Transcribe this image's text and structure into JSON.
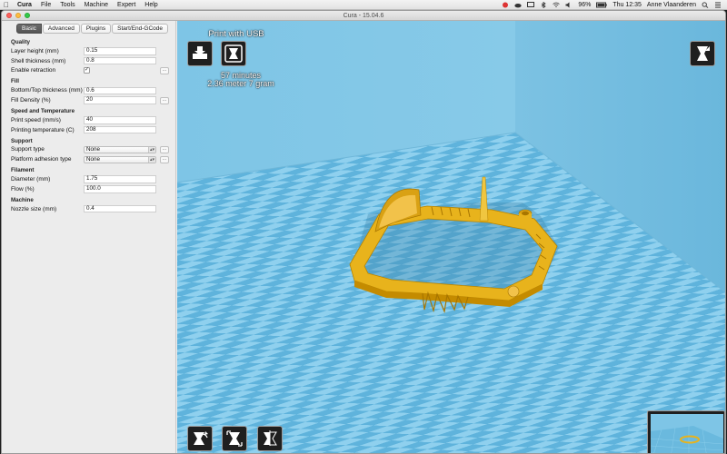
{
  "menubar": {
    "app": "Cura",
    "items": [
      "File",
      "Tools",
      "Machine",
      "Expert",
      "Help"
    ],
    "battery": "96%",
    "clock": "Thu 12:35",
    "user": "Anne Vlaanderen"
  },
  "window": {
    "title": "Cura - 15.04.6"
  },
  "tabs": [
    "Basic",
    "Advanced",
    "Plugins",
    "Start/End-GCode"
  ],
  "sections": {
    "quality": {
      "title": "Quality",
      "layer_height_label": "Layer height (mm)",
      "layer_height": "0.15",
      "shell_thickness_label": "Shell thickness (mm)",
      "shell_thickness": "0.8",
      "retraction_label": "Enable retraction",
      "retraction_checked": "✓",
      "more": "..."
    },
    "fill": {
      "title": "Fill",
      "bottom_top_label": "Bottom/Top thickness (mm)",
      "bottom_top": "0.6",
      "density_label": "Fill Density (%)",
      "density": "20",
      "more": "..."
    },
    "speed": {
      "title": "Speed and Temperature",
      "print_speed_label": "Print speed (mm/s)",
      "print_speed": "40",
      "temp_label": "Printing temperature (C)",
      "temp": "208"
    },
    "support": {
      "title": "Support",
      "type_label": "Support type",
      "type": "None",
      "adhesion_label": "Platform adhesion type",
      "adhesion": "None",
      "more": "..."
    },
    "filament": {
      "title": "Filament",
      "diameter_label": "Diameter (mm)",
      "diameter": "1.75",
      "flow_label": "Flow (%)",
      "flow": "100.0"
    },
    "machine": {
      "title": "Machine",
      "nozzle_label": "Nozzle size (mm)",
      "nozzle": "0.4"
    }
  },
  "viewport": {
    "print_label": "Print with USB",
    "time": "57 minutes",
    "material": "2.36 meter 7 gram"
  },
  "colors": {
    "model": "#e8b31c",
    "floor_light": "#8fd0ee",
    "floor_dark": "#5ab0d8",
    "wall": "#8fcbe6"
  },
  "icons": {
    "load": "load-model-icon",
    "print": "print-usb-icon",
    "view": "view-mode-icon",
    "rotate": "rotate-icon",
    "scale": "scale-icon",
    "mirror": "mirror-icon"
  }
}
